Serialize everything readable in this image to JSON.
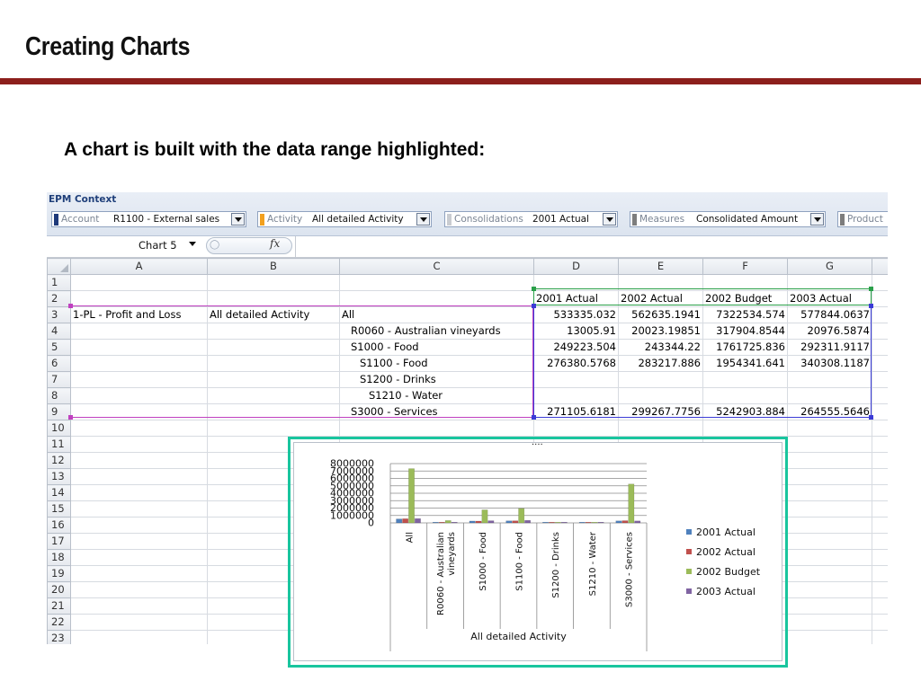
{
  "slide": {
    "title": "Creating Charts",
    "subtitle": "A chart is built with the data range highlighted:"
  },
  "epm": {
    "label": "EPM Context",
    "dropdowns": [
      {
        "label": "Account",
        "value": "R1100 - External sales",
        "color": "#1f3a7a"
      },
      {
        "label": "Activity",
        "value": "All detailed Activity",
        "color": "#f2a01e"
      },
      {
        "label": "Consolidations",
        "value": "2001 Actual",
        "color": "#c9ccd1"
      },
      {
        "label": "Measures",
        "value": "Consolidated Amount",
        "color": "#7d7d7d"
      },
      {
        "label": "Product",
        "value": "",
        "color": "#7d7d7d"
      }
    ]
  },
  "formula_bar": {
    "name_box": "Chart 5",
    "fx": "fx"
  },
  "sheet": {
    "columns": [
      "A",
      "B",
      "C",
      "D",
      "E",
      "F",
      "G"
    ],
    "rows": [
      {
        "n": "1",
        "c": [
          "",
          "",
          "",
          "",
          "",
          "",
          ""
        ]
      },
      {
        "n": "2",
        "c": [
          "",
          "",
          "",
          "2001 Actual",
          "2002 Actual",
          "2002 Budget",
          "2003 Actual"
        ]
      },
      {
        "n": "3",
        "c": [
          "1-PL - Profit and Loss",
          "All detailed Activity",
          "All",
          "533335.032",
          "562635.1941",
          "7322534.574",
          "577844.0637"
        ]
      },
      {
        "n": "4",
        "c": [
          "",
          "",
          "R0060 - Australian vineyards",
          "13005.91",
          "20023.19851",
          "317904.8544",
          "20976.5874"
        ]
      },
      {
        "n": "5",
        "c": [
          "",
          "",
          "S1000 - Food",
          "249223.504",
          "243344.22",
          "1761725.836",
          "292311.9117"
        ]
      },
      {
        "n": "6",
        "c": [
          "",
          "",
          "S1100 - Food",
          "276380.5768",
          "283217.886",
          "1954341.641",
          "340308.1187"
        ]
      },
      {
        "n": "7",
        "c": [
          "",
          "",
          "S1200 - Drinks",
          "",
          "",
          "",
          ""
        ]
      },
      {
        "n": "8",
        "c": [
          "",
          "",
          "S1210 - Water",
          "",
          "",
          "",
          ""
        ]
      },
      {
        "n": "9",
        "c": [
          "",
          "",
          "S3000 - Services",
          "271105.6181",
          "299267.7756",
          "5242903.884",
          "264555.5646"
        ]
      },
      {
        "n": "10",
        "c": [
          "",
          "",
          "",
          "",
          "",
          "",
          ""
        ]
      },
      {
        "n": "11",
        "c": [
          "",
          "",
          "",
          "",
          "",
          "",
          ""
        ]
      },
      {
        "n": "12",
        "c": [
          "",
          "",
          "",
          "",
          "",
          "",
          ""
        ]
      },
      {
        "n": "13",
        "c": [
          "",
          "",
          "",
          "",
          "",
          "",
          ""
        ]
      },
      {
        "n": "14",
        "c": [
          "",
          "",
          "",
          "",
          "",
          "",
          ""
        ]
      },
      {
        "n": "15",
        "c": [
          "",
          "",
          "",
          "",
          "",
          "",
          ""
        ]
      },
      {
        "n": "16",
        "c": [
          "",
          "",
          "",
          "",
          "",
          "",
          ""
        ]
      },
      {
        "n": "17",
        "c": [
          "",
          "",
          "",
          "",
          "",
          "",
          ""
        ]
      },
      {
        "n": "18",
        "c": [
          "",
          "",
          "",
          "",
          "",
          "",
          ""
        ]
      },
      {
        "n": "19",
        "c": [
          "",
          "",
          "",
          "",
          "",
          "",
          ""
        ]
      },
      {
        "n": "20",
        "c": [
          "",
          "",
          "",
          "",
          "",
          "",
          ""
        ]
      },
      {
        "n": "21",
        "c": [
          "",
          "",
          "",
          "",
          "",
          "",
          ""
        ]
      },
      {
        "n": "22",
        "c": [
          "",
          "",
          "",
          "",
          "",
          "",
          ""
        ]
      },
      {
        "n": "23",
        "c": [
          "",
          "",
          "",
          "",
          "",
          "",
          ""
        ]
      }
    ]
  },
  "chart_data": {
    "type": "bar",
    "categories": [
      "All",
      "R0060 - Australian vineyards",
      "S1000 - Food",
      "S1100 - Food",
      "S1200 - Drinks",
      "S1210 - Water",
      "S3000 - Services"
    ],
    "category_display": [
      [
        "All"
      ],
      [
        "R0060 - Australian",
        "vineyards"
      ],
      [
        "S1000 - Food"
      ],
      [
        "S1100 - Food"
      ],
      [
        "S1200 - Drinks"
      ],
      [
        "S1210 - Water"
      ],
      [
        "S3000 - Services"
      ]
    ],
    "series": [
      {
        "name": "2001 Actual",
        "color": "#4f81bd",
        "values": [
          533335.032,
          13005.91,
          249223.504,
          276380.5768,
          0,
          0,
          271105.6181
        ]
      },
      {
        "name": "2002 Actual",
        "color": "#c0504d",
        "values": [
          562635.1941,
          20023.19851,
          243344.22,
          283217.886,
          0,
          0,
          299267.7756
        ]
      },
      {
        "name": "2002 Budget",
        "color": "#9bbb59",
        "values": [
          7322534.574,
          317904.8544,
          1761725.836,
          1954341.641,
          0,
          0,
          5242903.884
        ]
      },
      {
        "name": "2003 Actual",
        "color": "#8064a2",
        "values": [
          577844.0637,
          20976.5874,
          292311.9117,
          340308.1187,
          0,
          0,
          264555.5646
        ]
      }
    ],
    "xlabel": "All detailed Activity",
    "ylabel": "",
    "ylim": [
      0,
      8000000
    ],
    "yticks": [
      0,
      1000000,
      2000000,
      3000000,
      4000000,
      5000000,
      6000000,
      7000000,
      8000000
    ],
    "grid": true,
    "legend": "right"
  }
}
